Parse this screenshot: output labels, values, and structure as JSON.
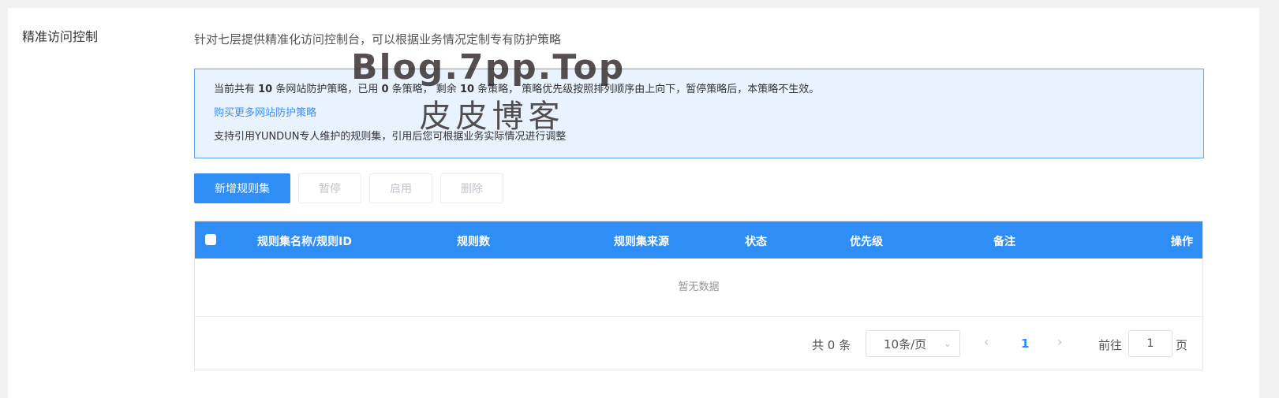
{
  "section": {
    "title": "精准访问控制"
  },
  "intro": "针对七层提供精准化访问控制台，可以根据业务情况定制专有防护策略",
  "watermark": {
    "line1": "Blog.7pp.Top",
    "line2": "皮皮博客"
  },
  "notice": {
    "line1_prefix": "当前共有 ",
    "total_count": "10",
    "line1_mid1": " 条网站防护策略，已用 ",
    "used_count": "0",
    "line1_mid2": " 条策略， 剩余 ",
    "remaining_count": "10",
    "line1_suffix": " 条策略， 策略优先级按照排列顺序由上向下，暂停策略后，本策略不生效。",
    "buy_link": "购买更多网站防护策略",
    "line3": "支持引用YUNDUN专人维护的规则集，引用后您可根据业务实际情况进行调整"
  },
  "toolbar": {
    "add": "新增规则集",
    "pause": "暂停",
    "enable": "启用",
    "delete": "删除"
  },
  "table": {
    "columns": [
      "规则集名称/规则ID",
      "规则数",
      "规则集来源",
      "状态",
      "优先级",
      "备注",
      "操作"
    ],
    "empty_text": "暂无数据"
  },
  "pagination": {
    "total": "共 0 条",
    "page_size": "10条/页",
    "current_page": "1",
    "goto_label": "前往",
    "goto_value": "1",
    "goto_unit": "页"
  },
  "colors": {
    "primary": "#2f8ef5",
    "notice_bg": "#e8f3ff",
    "notice_border": "#5aa3f5"
  }
}
